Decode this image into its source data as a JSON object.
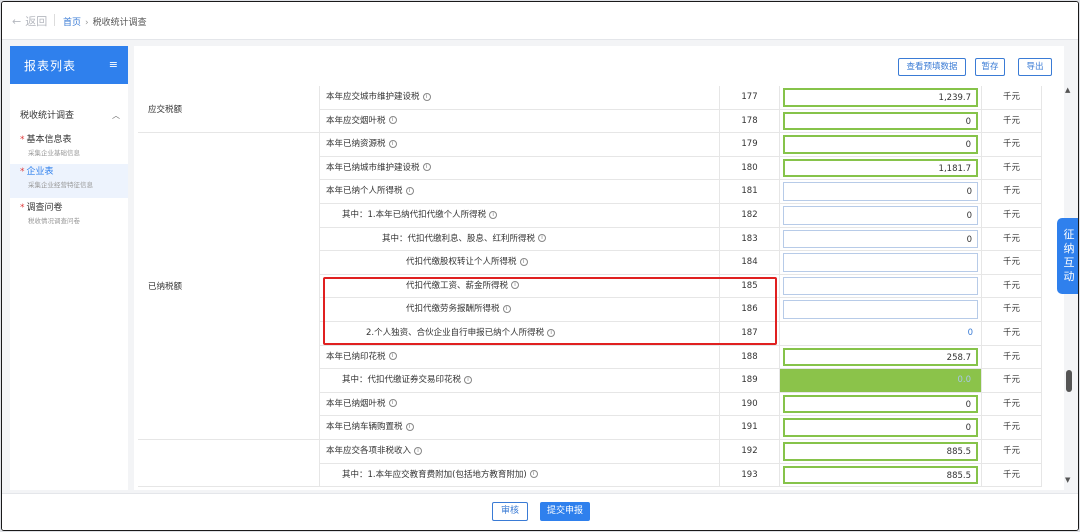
{
  "header": {
    "back_label": "返回",
    "breadcrumb_home": "首页",
    "breadcrumb_sep": "›",
    "breadcrumb_current": "税收统计调查"
  },
  "sidebar": {
    "title": "报表列表",
    "menu_icon": "≡",
    "group": "税收统计调查",
    "items": [
      {
        "star": "*",
        "label": "基本信息表",
        "sub": "采集企业基础信息"
      },
      {
        "star": "*",
        "label": "企业表",
        "sub": "采集企业经营特征信息"
      },
      {
        "star": "*",
        "label": "调查问卷",
        "sub": "税收情况调查问卷"
      }
    ]
  },
  "toolbar": {
    "preview": "查看预填数据",
    "save": "暂存",
    "export": "导出"
  },
  "table": {
    "categories": [
      {
        "label": "应交税额"
      },
      {
        "label": "已纳税额"
      },
      {
        "label": ""
      }
    ],
    "rows": [
      {
        "name": "本年应交城市维护建设税",
        "no": "177",
        "value": "1,239.7",
        "unit": "千元",
        "style": "green"
      },
      {
        "name": "本年应交烟叶税",
        "no": "178",
        "value": "0",
        "unit": "千元",
        "style": "green"
      },
      {
        "name": "本年已纳资源税",
        "no": "179",
        "value": "0",
        "unit": "千元",
        "style": "green"
      },
      {
        "name": "本年已纳城市维护建设税",
        "no": "180",
        "value": "1,181.7",
        "unit": "千元",
        "style": "green"
      },
      {
        "name": "本年已纳个人所得税",
        "no": "181",
        "value": "0",
        "unit": "千元",
        "style": "blue"
      },
      {
        "name": "其中：1.本年已纳代扣代缴个人所得税",
        "no": "182",
        "value": "0",
        "unit": "千元",
        "style": "blue"
      },
      {
        "name": "其中：代扣代缴利息、股息、红利所得税",
        "no": "183",
        "value": "0",
        "unit": "千元",
        "style": "blue"
      },
      {
        "name": "代扣代缴股权转让个人所得税",
        "no": "184",
        "value": "",
        "unit": "千元",
        "style": "blue"
      },
      {
        "name": "代扣代缴工资、薪金所得税",
        "no": "185",
        "value": "",
        "unit": "千元",
        "style": "blue"
      },
      {
        "name": "代扣代缴劳务报酬所得税",
        "no": "186",
        "value": "",
        "unit": "千元",
        "style": "blue"
      },
      {
        "name": "2.个人独资、合伙企业自行申报已纳个人所得税",
        "no": "187",
        "value": "0",
        "unit": "千元",
        "style": "plain"
      },
      {
        "name": "本年已纳印花税",
        "no": "188",
        "value": "258.7",
        "unit": "千元",
        "style": "green"
      },
      {
        "name": "其中：代扣代缴证券交易印花税",
        "no": "189",
        "value": "0.0",
        "unit": "千元",
        "style": "fill"
      },
      {
        "name": "本年已纳烟叶税",
        "no": "190",
        "value": "0",
        "unit": "千元",
        "style": "green"
      },
      {
        "name": "本年已纳车辆购置税",
        "no": "191",
        "value": "0",
        "unit": "千元",
        "style": "green"
      },
      {
        "name": "本年应交各项非税收入",
        "no": "192",
        "value": "885.5",
        "unit": "千元",
        "style": "green"
      },
      {
        "name": "其中：1.本年应交教育费附加(包括地方教育附加)",
        "no": "193",
        "value": "885.5",
        "unit": "千元",
        "style": "green"
      }
    ]
  },
  "side_float": {
    "chars": [
      "征",
      "纳",
      "互",
      "动"
    ]
  },
  "scroll": {
    "up": "▲",
    "down": "▼"
  },
  "info_mark": "i",
  "footer": {
    "review": "审核",
    "submit": "提交申报"
  }
}
